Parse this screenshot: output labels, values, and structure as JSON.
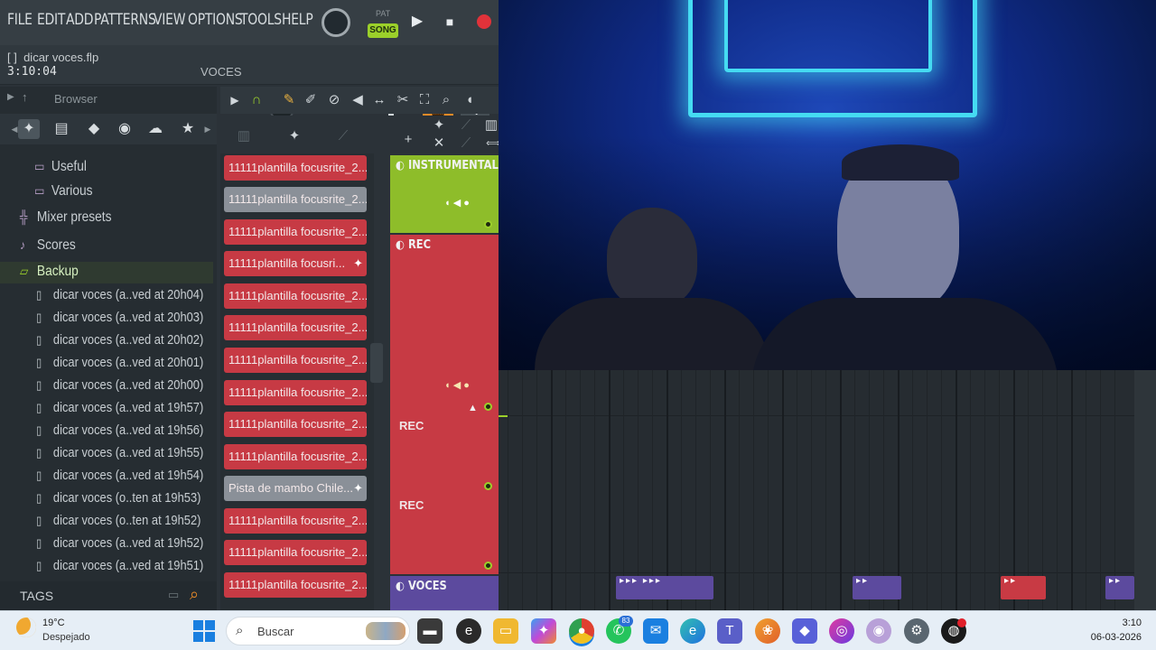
{
  "menu": [
    "FILE",
    "EDIT",
    "ADD",
    "PATTERNS",
    "VIEW",
    "OPTIONS",
    "TOOLS",
    "HELP"
  ],
  "transport": {
    "pat_label": "PAT",
    "song_label": "SONG",
    "play_icon": "play-icon",
    "stop_icon": "stop-icon",
    "record_icon": "record-icon"
  },
  "project": {
    "bracket": "[ ]",
    "file": "dicar voces.flp",
    "time": "3:10:04",
    "channel": "VOCES"
  },
  "browser": {
    "title": "Browser",
    "tree": [
      {
        "label": "Useful",
        "icon": "folder-icon"
      },
      {
        "label": "Various",
        "icon": "folder-icon"
      },
      {
        "label": "Mixer presets",
        "icon": "mixer-icon"
      },
      {
        "label": "Scores",
        "icon": "note-icon"
      },
      {
        "label": "Backup",
        "icon": "folder-open-icon"
      }
    ],
    "files": [
      "dicar voces (a..ved at 20h04)",
      "dicar voces (a..ved at 20h03)",
      "dicar voces (a..ved at 20h02)",
      "dicar voces (a..ved at 20h01)",
      "dicar voces (a..ved at 20h00)",
      "dicar voces (a..ved at 19h57)",
      "dicar voces (a..ved at 19h56)",
      "dicar voces (a..ved at 19h55)",
      "dicar voces (a..ved at 19h54)",
      "dicar voces (o..ten at 19h53)",
      "dicar voces (o..ten at 19h52)",
      "dicar voces (a..ved at 19h52)",
      "dicar voces (a..ved at 19h51)"
    ],
    "tags_label": "TAGS"
  },
  "clips": [
    "11111plantilla focusrite_2...",
    "11111plantilla focusrite_2...",
    "11111plantilla focusrite_2...",
    "11111plantilla focusri...",
    "11111plantilla focusrite_2...",
    "11111plantilla focusrite_2...",
    "11111plantilla focusrite_2...",
    "11111plantilla focusrite_2...",
    "11111plantilla focusrite_2...",
    "11111plantilla focusrite_2...",
    "Pista de mambo Chile...",
    "11111plantilla focusrite_2...",
    "11111plantilla focusrite_2...",
    "11111plantilla focusrite_2..."
  ],
  "tracks": {
    "instrumental": "INSTRUMENTAL",
    "rec": "REC",
    "rec_sub1": "REC",
    "rec_sub2": "REC",
    "voces": "VOCES"
  },
  "colors": {
    "accent_green": "#9bd02a",
    "clip_red": "#c73a44",
    "accent_orange": "#e88a28",
    "voces_purple": "#5c4a9e"
  },
  "taskbar": {
    "temperature": "19°C",
    "weather": "Despejado",
    "search_placeholder": "Buscar",
    "whatsapp_badge": "83",
    "time": "3:10",
    "date": "06-03-2026"
  }
}
